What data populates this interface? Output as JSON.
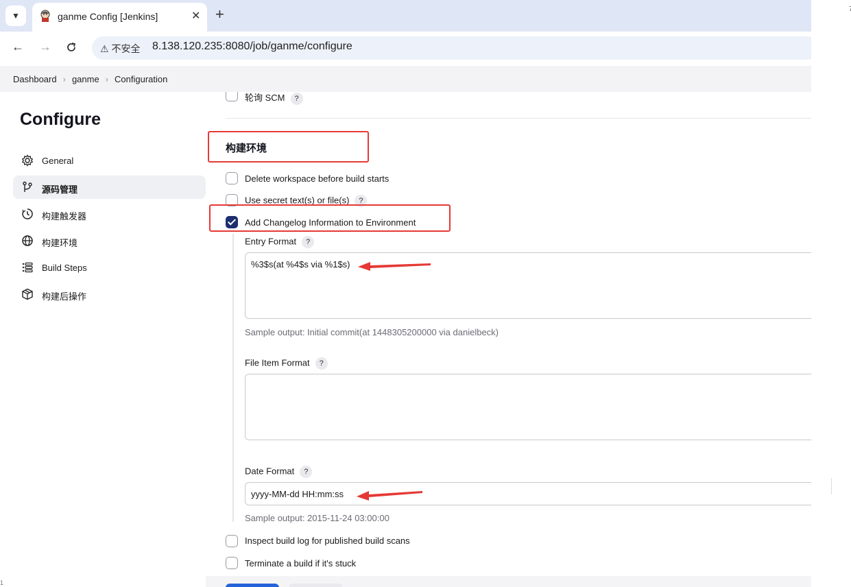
{
  "browser": {
    "tab_title": "ganme Config [Jenkins]",
    "tab_close": "✕",
    "new_tab": "+",
    "insecure_label": "⚠ 不安全",
    "url": "8.138.120.235:8080/job/ganme/configure"
  },
  "breadcrumb": {
    "items": [
      "Dashboard",
      "ganme",
      "Configuration"
    ],
    "separator": "›"
  },
  "sidebar": {
    "title": "Configure",
    "items": [
      {
        "label": "General",
        "icon": "gear-icon"
      },
      {
        "label": "源码管理",
        "icon": "branch-icon",
        "active": true
      },
      {
        "label": "构建触发器",
        "icon": "timer-icon"
      },
      {
        "label": "构建环境",
        "icon": "globe-icon"
      },
      {
        "label": "Build Steps",
        "icon": "list-icon"
      },
      {
        "label": "构建后操作",
        "icon": "package-icon"
      }
    ]
  },
  "main": {
    "poll_scm_label": "轮询 SCM",
    "section_title": "构建环境",
    "options": [
      {
        "label": "Delete workspace before build starts",
        "checked": false
      },
      {
        "label": "Use secret text(s) or file(s)",
        "checked": false,
        "help": "?"
      },
      {
        "label": "Add Changelog Information to Environment",
        "checked": true
      }
    ],
    "entry_format": {
      "label": "Entry Format",
      "value": "%3$s(at %4$s via %1$s)",
      "sample": "Sample output: Initial commit(at 1448305200000 via danielbeck)"
    },
    "file_item_format": {
      "label": "File Item Format",
      "value": ""
    },
    "date_format": {
      "label": "Date Format",
      "value": "yyyy-MM-dd HH:mm:ss",
      "sample": "Sample output: 2015-11-24 03:00:00"
    },
    "bottom_options": [
      {
        "label": "Inspect build log for published build scans",
        "checked": false
      },
      {
        "label": "Terminate a build if it's stuck",
        "checked": false
      }
    ],
    "help_mark": "?"
  },
  "margins": {
    "right_char": "7",
    "left_char": "1"
  },
  "colors": {
    "annotation_red": "#e53935",
    "checkbox_checked": "#1d2f6f",
    "primary_button": "#2563d9"
  }
}
